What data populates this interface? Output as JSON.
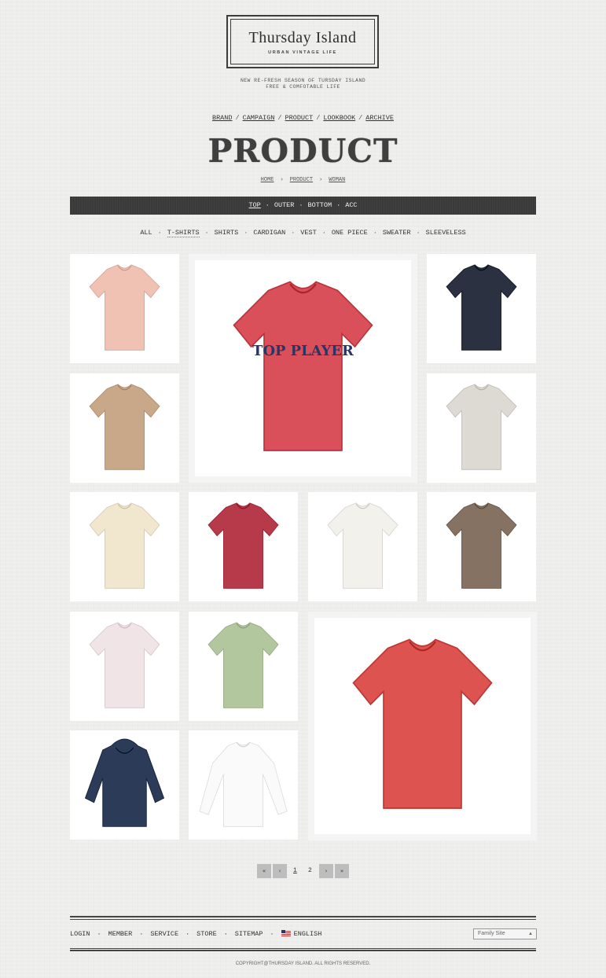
{
  "brand": {
    "name": "Thursday Island",
    "sub": "URBAN VINTAGE LIFE",
    "tagline1": "NEW RE-FRESH SEASON OF TURSDAY ISLAND",
    "tagline2": "FREE & COMFOTABLE LIFE"
  },
  "main_nav": [
    "BRAND",
    "CAMPAIGN",
    "PRODUCT",
    "LOOKBOOK",
    "ARCHIVE"
  ],
  "page_title": "PRODUCT",
  "breadcrumb": [
    "HOME",
    "PRODUCT",
    "WOMAN"
  ],
  "categories": [
    "TOP",
    "OUTER",
    "BOTTOM",
    "ACC"
  ],
  "subcategories": [
    "ALL",
    "T-SHIRTS",
    "SHIRTS",
    "CARDIGAN",
    "VEST",
    "ONE PIECE",
    "SWEATER",
    "SLEEVELESS"
  ],
  "products": [
    {
      "icon": "pink-tshirt-icon",
      "color": "#efc2b4",
      "print": ""
    },
    {
      "icon": "red-top-player-tshirt-icon",
      "color": "#d9505a",
      "print": "TOP PLAYER"
    },
    {
      "icon": "navy-patchwork-tshirt-icon",
      "color": "#2b3140",
      "print": ""
    },
    {
      "icon": "beige-tshirt-icon",
      "color": "#c9a889",
      "print": ""
    },
    {
      "icon": "striped-graphic-tshirt-icon",
      "color": "#dcdad2",
      "print": ""
    },
    {
      "icon": "cream-graphic-tshirt-icon",
      "color": "#f1e7cf",
      "print": ""
    },
    {
      "icon": "raspberry-tshirt-icon",
      "color": "#b73a4b",
      "print": ""
    },
    {
      "icon": "white-graphic-tshirt-icon",
      "color": "#f3f1ec",
      "print": ""
    },
    {
      "icon": "brown-graphic-tshirt-icon",
      "color": "#857262",
      "print": ""
    },
    {
      "icon": "pale-striped-tshirt-icon",
      "color": "#f1e4e6",
      "print": ""
    },
    {
      "icon": "sage-tshirt-icon",
      "color": "#b3c79f",
      "print": ""
    },
    {
      "icon": "red-floral-tshirt-icon",
      "color": "#dd5350",
      "print": ""
    },
    {
      "icon": "navy-floral-hoodie-icon",
      "color": "#2c3b58",
      "print": ""
    },
    {
      "icon": "white-longsleeve-icon",
      "color": "#fafafa",
      "print": ""
    }
  ],
  "pagination": {
    "first": "«",
    "prev": "‹",
    "next": "›",
    "last": "»",
    "pages": [
      "1",
      "2"
    ],
    "current": "1"
  },
  "footer_nav": [
    "LOGIN",
    "MEMBER",
    "SERVICE",
    "STORE",
    "SITEMAP",
    "ENGLISH"
  ],
  "family_site": "Family Site",
  "copyright": "COPYRIGHT@THURSDAY ISLAND. ALL RIGHTS RESERVED."
}
